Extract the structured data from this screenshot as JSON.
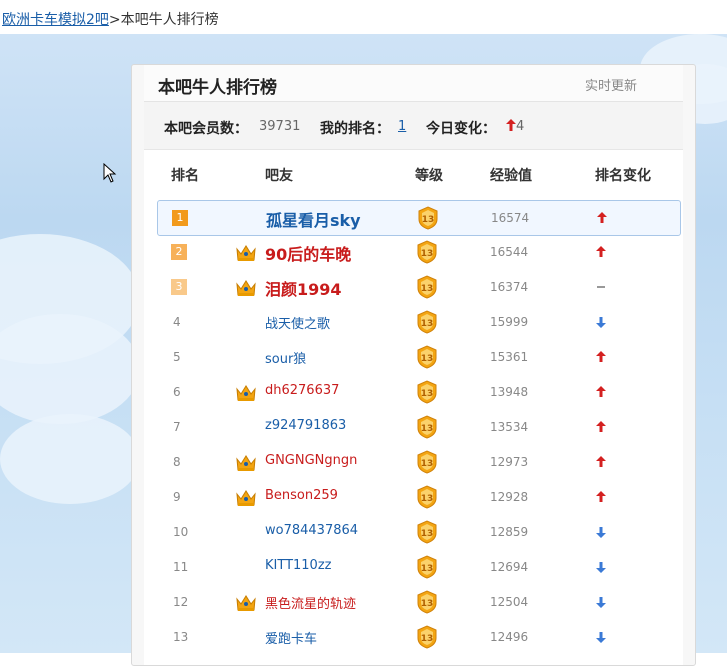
{
  "breadcrumb": {
    "forum": "欧洲卡车模拟2吧",
    "separator": ">",
    "current": "本吧牛人排行榜"
  },
  "panel": {
    "title": "本吧牛人排行榜",
    "live_update": "实时更新",
    "stats": {
      "members_label": "本吧会员数：",
      "members_value": "39731",
      "my_rank_label": "我的排名：",
      "my_rank_value": "1",
      "today_label": "今日变化：",
      "today_value": "4"
    },
    "columns": {
      "rank": "排名",
      "user": "吧友",
      "level": "等级",
      "exp": "经验值",
      "change": "排名变化"
    }
  },
  "colors": {
    "link_blue": "#1a5ea8",
    "vip_red": "#c81c1c",
    "up_red": "#d42020",
    "down_blue": "#3b7ad6",
    "badge_gold": "#f3a512"
  },
  "rows": [
    {
      "rank": "1",
      "name": "孤星看月sky",
      "level": "13",
      "exp": "16574",
      "change": "up",
      "crown": false,
      "name_style": "blue"
    },
    {
      "rank": "2",
      "name": "90后的车晚",
      "level": "13",
      "exp": "16544",
      "change": "up",
      "crown": true,
      "name_style": "red"
    },
    {
      "rank": "3",
      "name": "泪颜1994",
      "level": "13",
      "exp": "16374",
      "change": "same",
      "crown": true,
      "name_style": "red"
    },
    {
      "rank": "4",
      "name": "战天使之歌",
      "level": "13",
      "exp": "15999",
      "change": "down",
      "crown": false,
      "name_style": "blue"
    },
    {
      "rank": "5",
      "name": "sour狼",
      "level": "13",
      "exp": "15361",
      "change": "up",
      "crown": false,
      "name_style": "blue"
    },
    {
      "rank": "6",
      "name": "dh6276637",
      "level": "13",
      "exp": "13948",
      "change": "up",
      "crown": true,
      "name_style": "red"
    },
    {
      "rank": "7",
      "name": "z924791863",
      "level": "13",
      "exp": "13534",
      "change": "up",
      "crown": false,
      "name_style": "blue"
    },
    {
      "rank": "8",
      "name": "GNGNGNgngn",
      "level": "13",
      "exp": "12973",
      "change": "up",
      "crown": true,
      "name_style": "red"
    },
    {
      "rank": "9",
      "name": "Benson259",
      "level": "13",
      "exp": "12928",
      "change": "up",
      "crown": true,
      "name_style": "red"
    },
    {
      "rank": "10",
      "name": "wo784437864",
      "level": "13",
      "exp": "12859",
      "change": "down",
      "crown": false,
      "name_style": "blue"
    },
    {
      "rank": "11",
      "name": "KITT110zz",
      "level": "13",
      "exp": "12694",
      "change": "down",
      "crown": false,
      "name_style": "blue"
    },
    {
      "rank": "12",
      "name": "黑色流星的轨迹",
      "level": "13",
      "exp": "12504",
      "change": "down",
      "crown": true,
      "name_style": "red"
    },
    {
      "rank": "13",
      "name": "爱跑卡车",
      "level": "13",
      "exp": "12496",
      "change": "down",
      "crown": false,
      "name_style": "blue"
    }
  ]
}
